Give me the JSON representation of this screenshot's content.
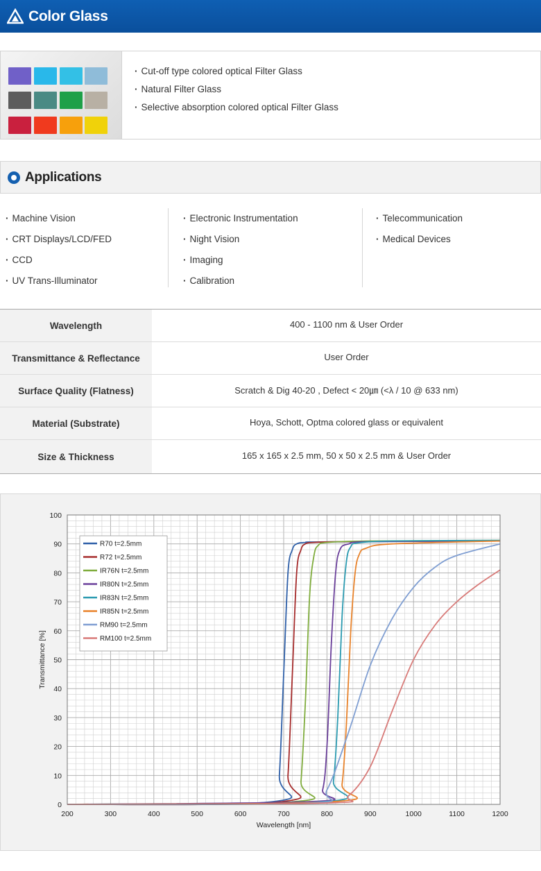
{
  "header": {
    "title": "Color Glass",
    "logo_icon": "triangle-logo-icon"
  },
  "intro": {
    "image": "color-glass-swatches",
    "swatch_colors": [
      "#7060c8",
      "#29b8ea",
      "#33c0e6",
      "#8fbcd9",
      "#5c5c5c",
      "#4a8a84",
      "#1ea048",
      "#b8b0a4",
      "#c9203e",
      "#f03a1e",
      "#f7a00c",
      "#f0d20a"
    ],
    "features": [
      "Cut-off type colored optical Filter Glass",
      "Natural Filter Glass",
      "Selective absorption colored optical Filter Glass"
    ]
  },
  "applications": {
    "title": "Applications",
    "columns": [
      [
        "Machine Vision",
        "CRT Displays/LCD/FED",
        "CCD",
        "UV Trans-Illuminator"
      ],
      [
        "Electronic Instrumentation",
        "Night Vision",
        "Imaging",
        "Calibration"
      ],
      [
        "Telecommunication",
        "Medical Devices"
      ]
    ]
  },
  "specs": [
    {
      "key": "Wavelength",
      "value": "400 - 1100 nm  & User Order"
    },
    {
      "key": "Transmittance & Reflectance",
      "value": "User Order"
    },
    {
      "key": "Surface Quality (Flatness)",
      "value": "Scratch & Dig 40-20 ,  Defect < 20㎛  (<λ / 10 @ 633 nm)"
    },
    {
      "key": "Material (Substrate)",
      "value": "Hoya, Schott, Optma colored glass or equivalent"
    },
    {
      "key": "Size &  Thickness",
      "value": "165 x 165 x 2.5 mm, 50 x 50 x 2.5 mm & User Order"
    }
  ],
  "chart_data": {
    "type": "line",
    "xlabel": "Wavelength [nm]",
    "ylabel": "Transmittance [%]",
    "xlim": [
      200,
      1200
    ],
    "ylim": [
      0,
      100
    ],
    "xticks": [
      200,
      300,
      400,
      500,
      600,
      700,
      800,
      900,
      1000,
      1100,
      1200
    ],
    "yticks": [
      0,
      10,
      20,
      30,
      40,
      50,
      60,
      70,
      80,
      90,
      100
    ],
    "grid": true,
    "legend_position": "top-left",
    "series": [
      {
        "name": "R70  t=2.5mm",
        "color": "#2e5fa8",
        "x": [
          200,
          680,
          690,
          700,
          710,
          720,
          730,
          750,
          800,
          1200
        ],
        "y": [
          0,
          1,
          10,
          45,
          80,
          88,
          90,
          90.5,
          90.7,
          91
        ]
      },
      {
        "name": "R72  t=2.5mm",
        "color": "#a52a2a",
        "x": [
          200,
          700,
          710,
          720,
          730,
          740,
          750,
          770,
          850,
          1200
        ],
        "y": [
          0,
          1,
          10,
          45,
          80,
          88,
          90,
          90.5,
          90.8,
          91
        ]
      },
      {
        "name": "IR76N  t=2.5mm",
        "color": "#7fac3c",
        "x": [
          200,
          730,
          740,
          750,
          760,
          770,
          780,
          800,
          900,
          1200
        ],
        "y": [
          0,
          1,
          8,
          35,
          72,
          86,
          89.5,
          90.5,
          91,
          91.2
        ]
      },
      {
        "name": "IR80N  t=2.5mm",
        "color": "#6a3f9a",
        "x": [
          200,
          770,
          790,
          800,
          810,
          820,
          830,
          850,
          900,
          1200
        ],
        "y": [
          0,
          1,
          5,
          20,
          55,
          80,
          88,
          90,
          90.8,
          91
        ]
      },
      {
        "name": "IR83N  t=2.5mm",
        "color": "#2a9ab0",
        "x": [
          200,
          800,
          815,
          825,
          835,
          845,
          855,
          870,
          950,
          1200
        ],
        "y": [
          0,
          1,
          8,
          30,
          65,
          84,
          89,
          90.3,
          91,
          91.2
        ]
      },
      {
        "name": "IR85N  t=2.5mm",
        "color": "#e8822a",
        "x": [
          200,
          820,
          835,
          845,
          855,
          865,
          875,
          890,
          950,
          1200
        ],
        "y": [
          0,
          1,
          7,
          28,
          60,
          80,
          86.5,
          88.5,
          90,
          91
        ]
      },
      {
        "name": "RM90  t=2.5mm",
        "color": "#7f9ed2",
        "x": [
          200,
          760,
          800,
          850,
          900,
          950,
          1000,
          1050,
          1100,
          1200
        ],
        "y": [
          0,
          0.5,
          5,
          25,
          48,
          64,
          75,
          82,
          86,
          90
        ]
      },
      {
        "name": "RM100  t=2.5mm",
        "color": "#d87a78",
        "x": [
          200,
          800,
          850,
          900,
          950,
          1000,
          1050,
          1100,
          1150,
          1200
        ],
        "y": [
          0,
          0.5,
          3,
          13,
          32,
          50,
          62,
          70,
          76,
          81
        ]
      }
    ]
  }
}
